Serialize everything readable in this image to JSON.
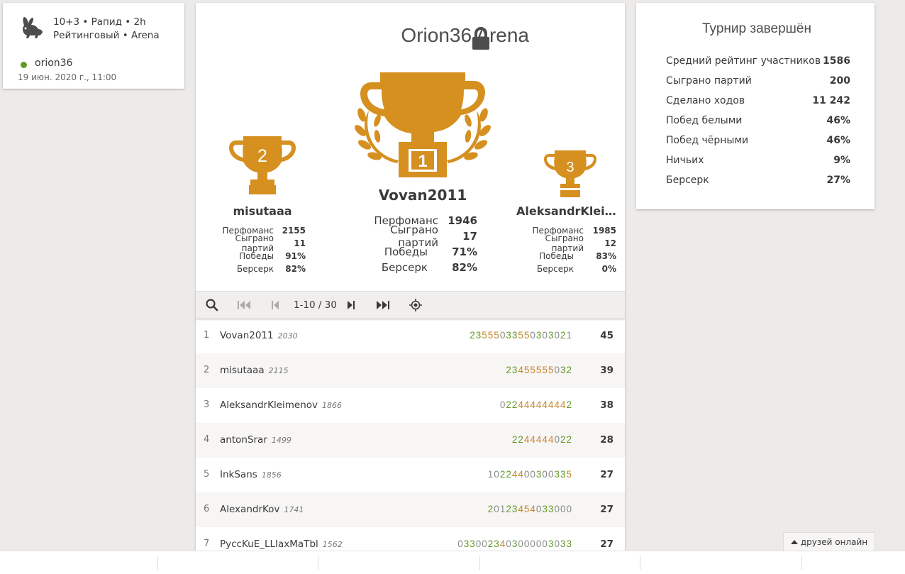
{
  "info": {
    "icon": "rabbit-icon",
    "line1": "10+3 • Рапид • 2h",
    "line2": "Рейтинговый • Arena",
    "creator": "orion36",
    "date": "19 июн. 2020 г., 11:00"
  },
  "center": {
    "title": "Orion36 Arena",
    "lock_icon": "lock-icon",
    "podium": {
      "first": {
        "rank": "1",
        "name": "Vovan2011",
        "stats": [
          {
            "label": "Перфоманс",
            "value": "1946"
          },
          {
            "label": "Сыграно партий",
            "value": "17"
          },
          {
            "label": "Победы",
            "value": "71%"
          },
          {
            "label": "Берсерк",
            "value": "82%"
          }
        ]
      },
      "second": {
        "rank": "2",
        "name": "misutaaa",
        "stats": [
          {
            "label": "Перфоманс",
            "value": "2155"
          },
          {
            "label": "Сыграно партий",
            "value": "11"
          },
          {
            "label": "Победы",
            "value": "91%"
          },
          {
            "label": "Берсерк",
            "value": "82%"
          }
        ]
      },
      "third": {
        "rank": "3",
        "name": "AleksandrKleimenov",
        "stats": [
          {
            "label": "Перфоманс",
            "value": "1985"
          },
          {
            "label": "Сыграно партий",
            "value": "12"
          },
          {
            "label": "Победы",
            "value": "83%"
          },
          {
            "label": "Берсерк",
            "value": "0%"
          }
        ]
      }
    },
    "pager": {
      "page_label": "1-10 / 30",
      "icons": [
        "search-icon",
        "first-page-icon",
        "prev-page-icon",
        "next-page-icon",
        "last-page-icon",
        "locate-me-icon"
      ]
    },
    "standings": [
      {
        "rank": "1",
        "name": "Vovan2011",
        "rating": "2030",
        "sheet": "23555033550303021",
        "total": "45"
      },
      {
        "rank": "2",
        "name": "misutaaa",
        "rating": "2115",
        "sheet": "23455555032",
        "total": "39"
      },
      {
        "rank": "3",
        "name": "AleksandrKleimenov",
        "rating": "1866",
        "sheet": "022444444442",
        "total": "38"
      },
      {
        "rank": "4",
        "name": "antonSrar",
        "rating": "1499",
        "sheet": "2244444022",
        "total": "28"
      },
      {
        "rank": "5",
        "name": "InkSans",
        "rating": "1856",
        "sheet": "10224400300335",
        "total": "27"
      },
      {
        "rank": "6",
        "name": "AlexandrKov",
        "rating": "1741",
        "sheet": "20123454033000",
        "total": "27"
      },
      {
        "rank": "7",
        "name": "PyccKuE_LLIaxMaTbl",
        "rating": "1562",
        "sheet": "0330023403000003033",
        "total": "27"
      }
    ]
  },
  "tournament_stats": {
    "title": "Турнир завершён",
    "rows": [
      {
        "label": "Средний рейтинг участников",
        "value": "1586"
      },
      {
        "label": "Сыграно партий",
        "value": "200"
      },
      {
        "label": "Сделано ходов",
        "value": "11 242"
      },
      {
        "label": "Побед белыми",
        "value": "46%"
      },
      {
        "label": "Побед чёрными",
        "value": "46%"
      },
      {
        "label": "Ничьих",
        "value": "9%"
      },
      {
        "label": "Берсерк",
        "value": "27%"
      }
    ]
  },
  "friends": {
    "label": "друзей онлайн",
    "icon": "caret-up-icon"
  },
  "colors": {
    "gold": "#d59020",
    "win": "#629924",
    "streak": "#c7862f",
    "loss": "#8a8a8a"
  }
}
